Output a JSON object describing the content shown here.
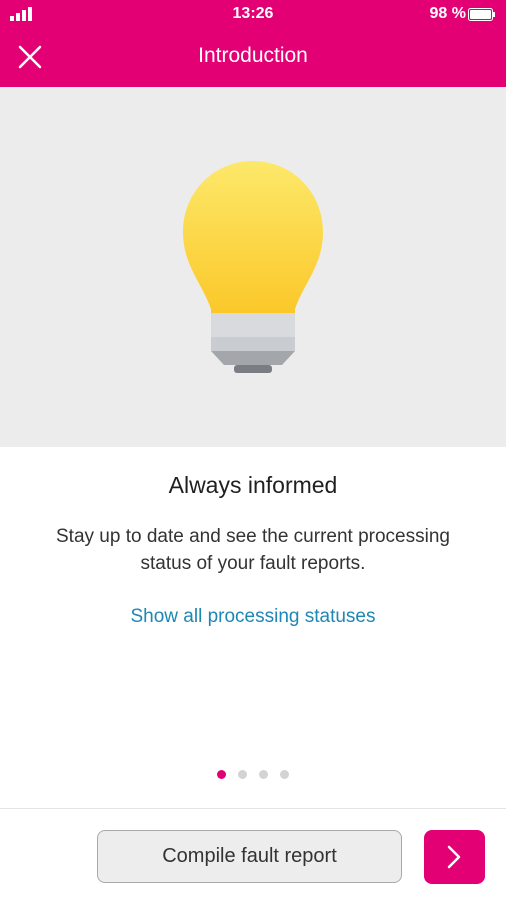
{
  "status_bar": {
    "time": "13:26",
    "battery_percent": "98 %",
    "signal_icon": "signal-bars-icon",
    "battery_icon": "battery-icon"
  },
  "nav": {
    "title": "Introduction",
    "close_icon": "close-icon"
  },
  "hero": {
    "illustration": "lightbulb-icon"
  },
  "content": {
    "headline": "Always informed",
    "body": "Stay up to date and see the current processing status of your fault reports.",
    "link": "Show all processing statuses"
  },
  "pager": {
    "current_page": 1,
    "total_pages": 4
  },
  "footer": {
    "primary_button": "Compile fault report",
    "next_icon": "chevron-right-icon"
  },
  "colors": {
    "brand": "#e20074",
    "link": "#1e87b4",
    "bulb": "#fcd535"
  }
}
